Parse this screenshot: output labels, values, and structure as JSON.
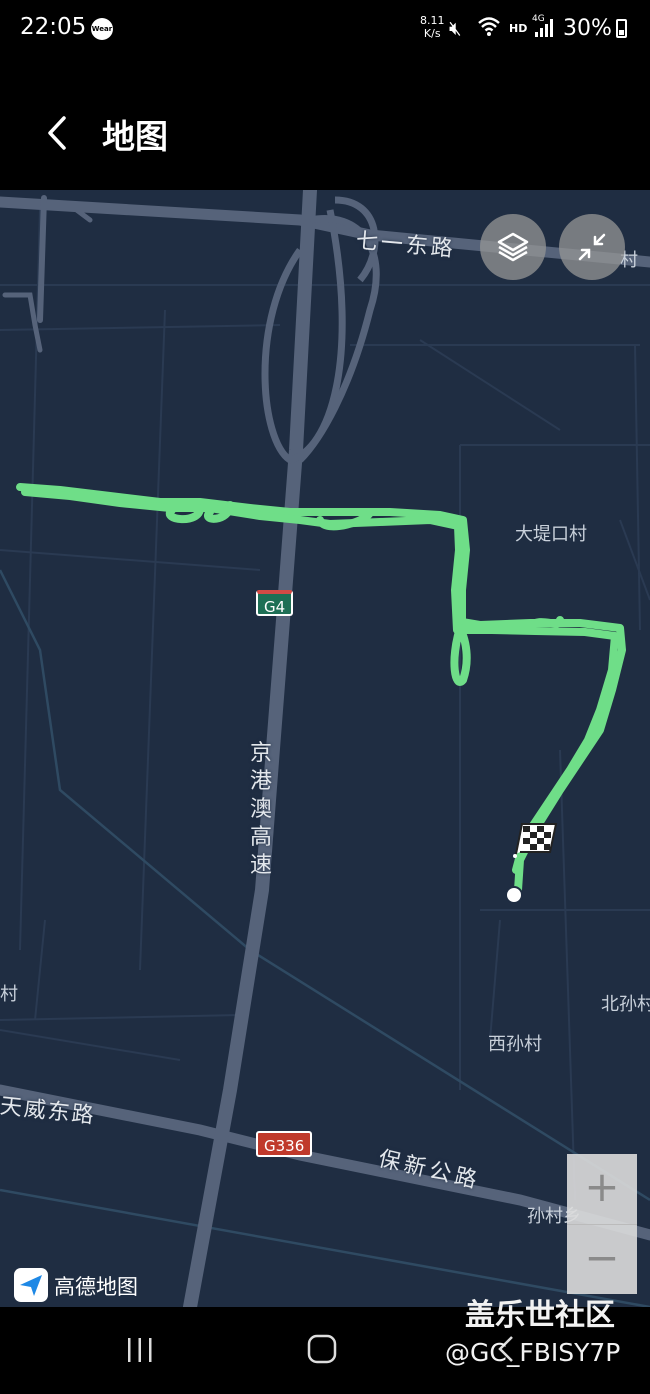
{
  "status_bar": {
    "time": "22:05",
    "wear_badge": "Wear",
    "net_rate_value": "8.11",
    "net_rate_unit": "K/s",
    "hd": "HD",
    "network": "4G",
    "battery": "30%"
  },
  "header": {
    "title": "地图"
  },
  "map": {
    "labels": {
      "village_dadikou": "大堤口村",
      "road_qiyi": "七一东路",
      "highway_jinggangao": "京港澳高速",
      "village_beisun": "北孙村",
      "village_xisun": "西孙村",
      "village_left": "村",
      "road_tianwei": "天威东路",
      "road_baoxin": "保新公路",
      "town_sun": "孙村乡",
      "partial_top_right": "村"
    },
    "shields": {
      "g4": "G4",
      "g336": "G336"
    },
    "colors": {
      "background": "#1f2d42",
      "track": "#6fde88",
      "road": "#5e6b82"
    },
    "logo_text": "高德地图"
  },
  "controls": {
    "layers_icon": "layers-icon",
    "collapse_icon": "collapse-icon",
    "zoom_in": "+",
    "zoom_out": "−"
  },
  "watermark": {
    "line1": "盖乐世社区",
    "line2": "@GC_FBISY7P"
  }
}
